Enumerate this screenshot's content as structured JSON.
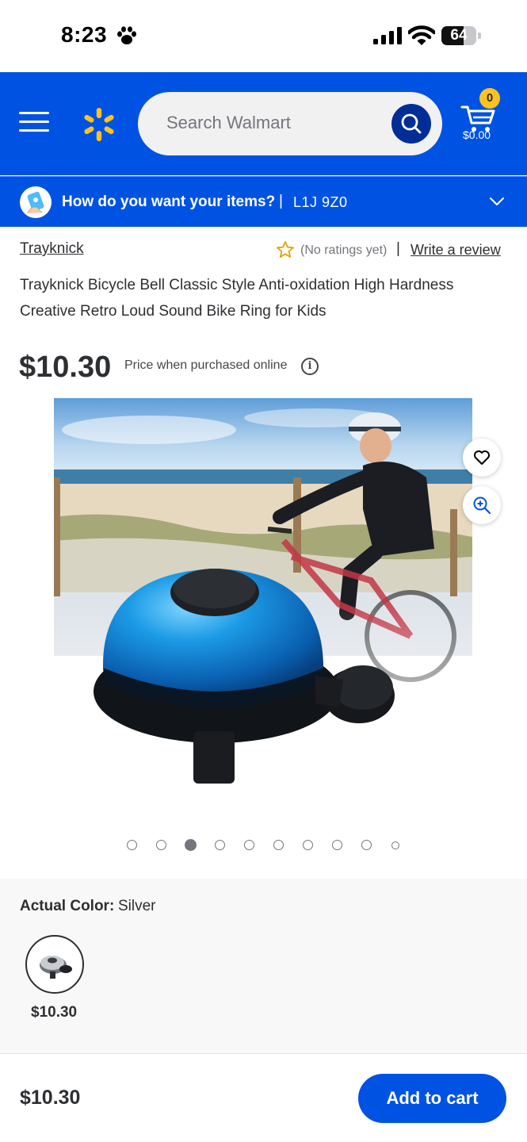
{
  "status_bar": {
    "time": "8:23",
    "battery": "64",
    "battery_level": 0.64
  },
  "header": {
    "search_placeholder": "Search Walmart",
    "cart_count": "0",
    "cart_total": "$0.00",
    "brand_color": "#0053e2",
    "accent_color": "#ffc220"
  },
  "delivery": {
    "question": "How do you want your items?",
    "separator": "|",
    "postal_code": "L1J 9Z0"
  },
  "product": {
    "brand": "Trayknick",
    "rating_text": "(No ratings yet)",
    "rating_separator": "|",
    "write_review": "Write a review",
    "title": "Trayknick Bicycle Bell Classic Style Anti-oxidation High Hardness Creative Retro Loud Sound Bike Ring for Kids",
    "price": "$10.30",
    "price_note": "Price when purchased online",
    "info_icon": "i"
  },
  "gallery": {
    "total_images": 10,
    "active_index": 2
  },
  "variant": {
    "label": "Actual Color:",
    "selected": "Silver",
    "options": [
      {
        "price": "$10.30"
      }
    ]
  },
  "footer": {
    "price": "$10.30",
    "add_to_cart": "Add to cart"
  }
}
